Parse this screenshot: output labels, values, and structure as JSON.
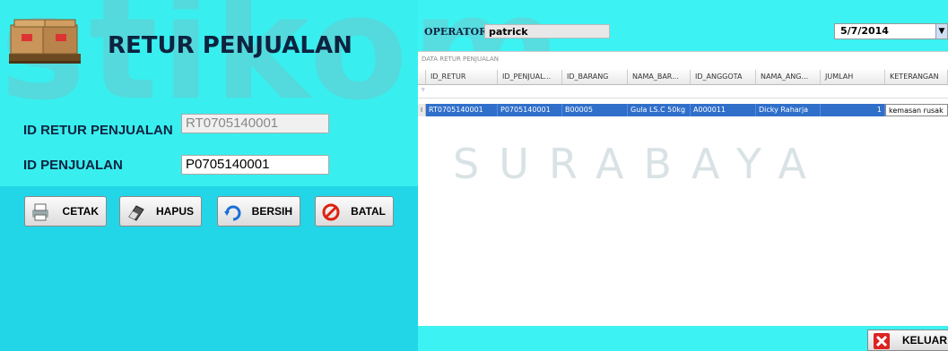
{
  "watermark": {
    "main": "stikom",
    "sub": "SURABAYA"
  },
  "form": {
    "title": "RETUR PENJUALAN",
    "id_retur_label": "ID RETUR PENJUALAN",
    "id_retur_value": "RT0705140001",
    "id_penjualan_label": "ID PENJUALAN",
    "id_penjualan_value": "P0705140001"
  },
  "buttons": {
    "cetak": "CETAK",
    "hapus": "HAPUS",
    "bersih": "BERSIH",
    "batal": "BATAL",
    "keluar": "KELUAR"
  },
  "header": {
    "operator_label": "OPERATOR",
    "operator_value": "patrick",
    "date": "5/7/2014"
  },
  "grid": {
    "caption": "DATA RETUR PENJUALAN",
    "columns": [
      "ID_RETUR",
      "ID_PENJUAL...",
      "ID_BARANG",
      "NAMA_BAR...",
      "ID_ANGGOTA",
      "NAMA_ANG...",
      "JUMLAH",
      "KETERANGAN"
    ],
    "filter_icon": "filter-icon",
    "rows": [
      [
        "RT0705140001",
        "P0705140001",
        "B00005",
        "Gula LS.C 50kg",
        "A000011",
        "Dicky Raharja",
        "1",
        "kemasan rusak"
      ]
    ]
  },
  "colors": {
    "bg": "#3cf2f2",
    "panel_lower": "#22d6e8",
    "row_selected": "#2f6fca",
    "title": "#0d2340"
  }
}
